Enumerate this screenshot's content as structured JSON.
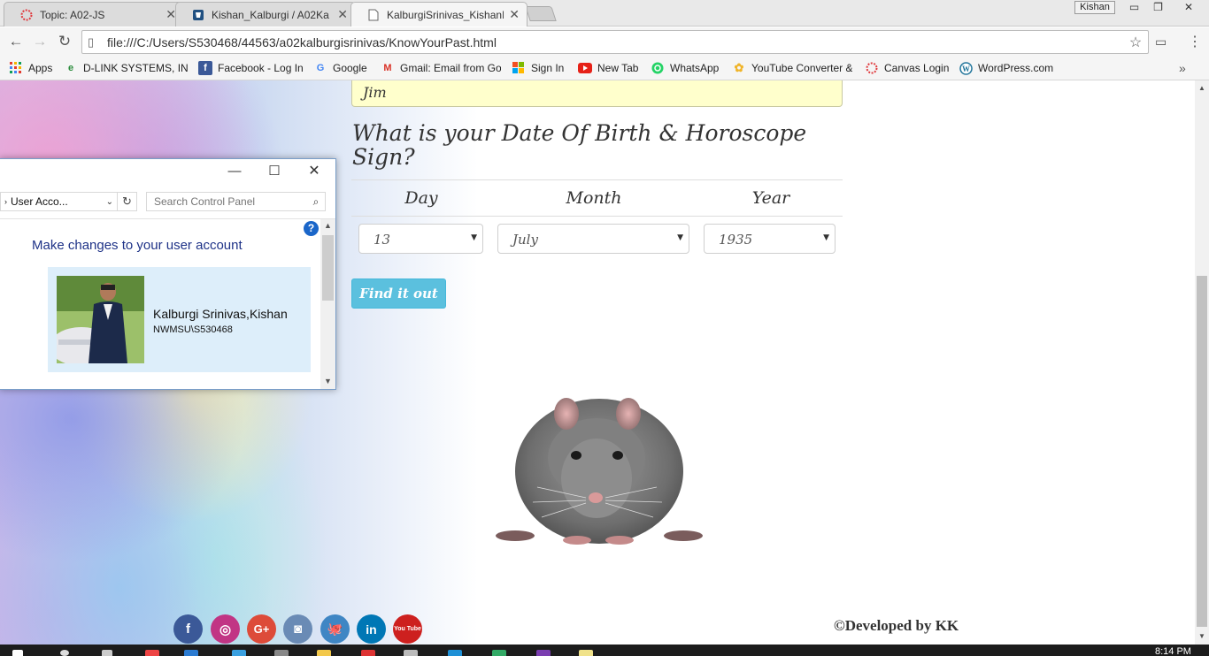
{
  "browser": {
    "tabs": [
      {
        "title": "Topic: A02-JS",
        "favicon": "canvas-icon",
        "active": false
      },
      {
        "title": "Kishan_Kalburgi / A02Ka",
        "favicon": "bitbucket-icon",
        "active": false
      },
      {
        "title": "KalburgiSrinivas_KishanH",
        "favicon": "page-icon",
        "active": true
      }
    ],
    "profile_name": "Kishan",
    "url": "file:///C:/Users/S530468/44563/a02kalburgisrinivas/KnowYourPast.html",
    "bookmarks": [
      {
        "label": "Apps",
        "icon": "apps-grid-icon",
        "color": "#e33b2e"
      },
      {
        "label": "D-LINK SYSTEMS, INC",
        "icon": "dlink-icon",
        "color": "#2a8c3c"
      },
      {
        "label": "Facebook - Log In",
        "icon": "facebook-icon",
        "color": "#3b5998"
      },
      {
        "label": "Google",
        "icon": "google-icon",
        "color": "#4285f4"
      },
      {
        "label": "Gmail: Email from Go",
        "icon": "gmail-icon",
        "color": "#d93025"
      },
      {
        "label": "Sign In",
        "icon": "microsoft-icon",
        "color": "#f25022"
      },
      {
        "label": "New Tab",
        "icon": "youtube-icon",
        "color": "#e62117"
      },
      {
        "label": "WhatsApp",
        "icon": "whatsapp-icon",
        "color": "#25d366"
      },
      {
        "label": "YouTube Converter &",
        "icon": "converter-icon",
        "color": "#f0b429"
      },
      {
        "label": "Canvas Login",
        "icon": "canvas-icon",
        "color": "#e03a3e"
      },
      {
        "label": "WordPress.com",
        "icon": "wordpress-icon",
        "color": "#21759b"
      }
    ]
  },
  "page": {
    "name_value": "Jim",
    "question": "What is your Date Of Birth & Horoscope Sign?",
    "columns": {
      "day": "Day",
      "month": "Month",
      "year": "Year"
    },
    "selected": {
      "day": "13",
      "month": "July",
      "year": "1935"
    },
    "find_button": "Find it out",
    "horoscope_image": "rat",
    "social_icons": [
      {
        "name": "facebook-icon",
        "glyph": "f",
        "color": "#3b5998"
      },
      {
        "name": "instagram-icon",
        "glyph": "◎",
        "color": "#c13584"
      },
      {
        "name": "google-plus-icon",
        "glyph": "G+",
        "color": "#dd4b39"
      },
      {
        "name": "bucket-icon",
        "glyph": "◙",
        "color": "#6a8bb5"
      },
      {
        "name": "github-icon",
        "glyph": "🐙",
        "color": "#3f86c4"
      },
      {
        "name": "linkedin-icon",
        "glyph": "in",
        "color": "#0077b5"
      },
      {
        "name": "youtube-icon",
        "glyph": "You Tube",
        "color": "#cd201f"
      }
    ],
    "credit": "©Developed by KK"
  },
  "control_panel": {
    "breadcrumb": "User Acco...",
    "search_placeholder": "Search Control Panel",
    "heading": "Make changes to your user account",
    "user_name": "Kalburgi Srinivas,Kishan",
    "user_id": "NWMSU\\S530468"
  },
  "taskbar": {
    "time": "8:14 PM"
  }
}
